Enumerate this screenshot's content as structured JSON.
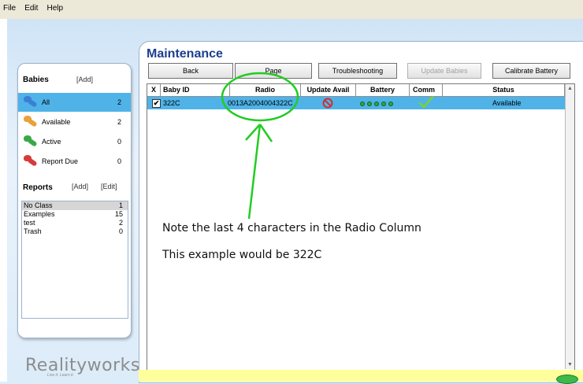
{
  "menu": [
    "File",
    "Edit",
    "Help"
  ],
  "babies": {
    "heading": "Babies",
    "add_label": "[Add]",
    "items": [
      {
        "label": "All",
        "count": "2",
        "pin_color": "#3a7fd6",
        "selected": true
      },
      {
        "label": "Available",
        "count": "2",
        "pin_color": "#e8a23a"
      },
      {
        "label": "Active",
        "count": "0",
        "pin_color": "#3aa84a"
      },
      {
        "label": "Report Due",
        "count": "0",
        "pin_color": "#d63a3a"
      }
    ]
  },
  "reports": {
    "heading": "Reports",
    "add_label": "[Add]",
    "edit_label": "[Edit]",
    "items": [
      {
        "label": "No Class",
        "count": "1"
      },
      {
        "label": "Examples",
        "count": "15"
      },
      {
        "label": "test",
        "count": "2"
      },
      {
        "label": "Trash",
        "count": "0"
      }
    ]
  },
  "logo": {
    "text": "Realityworks",
    "tagline": "Live it. Learn it."
  },
  "main": {
    "title": "Maintenance",
    "buttons": {
      "back": "Back",
      "page": "Page",
      "troubleshooting": "Troubleshooting",
      "update_babies": "Update Babies",
      "calibrate_battery": "Calibrate Battery"
    },
    "columns": {
      "x": "X",
      "baby_id": "Baby ID",
      "radio": "Radio",
      "update_avail": "Update Avail",
      "battery": "Battery",
      "comm": "Comm",
      "status": "Status"
    },
    "rows": [
      {
        "checked": true,
        "baby_id": "322C",
        "radio": "0013A2004004322C",
        "update_avail_icon": "no-entry-icon",
        "battery_level_of_5": 5,
        "comm_icon": "checkmark-icon",
        "status": "Available"
      }
    ]
  },
  "annotation": {
    "line1": "Note the last 4 characters in the Radio Column",
    "line2": "This example would be 322C",
    "color": "#22cc22"
  },
  "colors": {
    "selection": "#4fb3e8",
    "title": "#1b3f8f",
    "footer": "#ffff9c"
  }
}
